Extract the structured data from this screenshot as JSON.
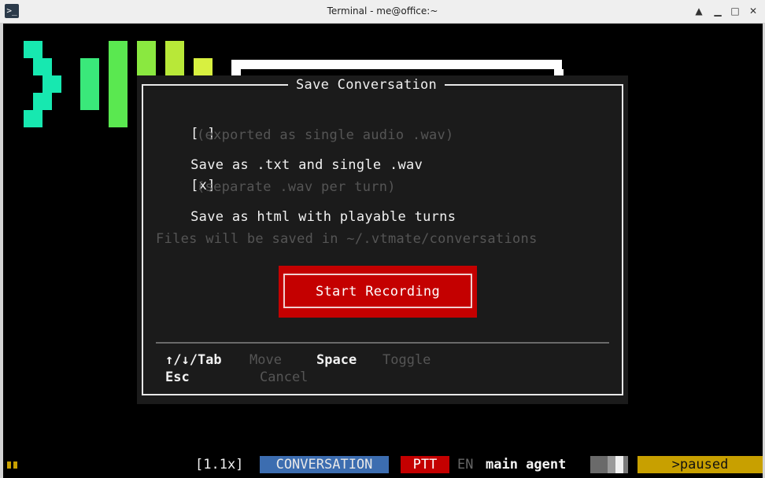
{
  "window": {
    "title": "Terminal - me@office:~",
    "app_icon": ">_",
    "controls": {
      "up": "▲",
      "minimize": "▁",
      "maximize": "□",
      "close": "✕"
    }
  },
  "modal": {
    "title": "Save Conversation",
    "options": [
      {
        "checkbox": "[ ]",
        "label": "Save as .txt and single .wav",
        "hint": "(exported as single audio .wav)"
      },
      {
        "checkbox": "[x]",
        "label": "Save as html with playable turns",
        "hint": "(separate .wav per turn)"
      }
    ],
    "path_note": "Files will be saved in ~/.vtmate/conversations",
    "start_button": "Start Recording",
    "shortcuts": [
      {
        "key": "↑/↓/Tab",
        "action": "Move"
      },
      {
        "key": "Space",
        "action": "Toggle"
      },
      {
        "key": "Esc",
        "action": "Cancel"
      }
    ]
  },
  "statusbar": {
    "speed": "[1.1x]",
    "mode": "CONVERSATION",
    "ptt": "PTT",
    "lang": "EN",
    "agent": "main agent",
    "state": ">paused"
  },
  "colors": {
    "terminal_bg": "#000000",
    "modal_bg": "#1b1b1b",
    "button_red": "#c40000",
    "mode_blue": "#3c6db0",
    "state_yellow": "#c8a000"
  }
}
